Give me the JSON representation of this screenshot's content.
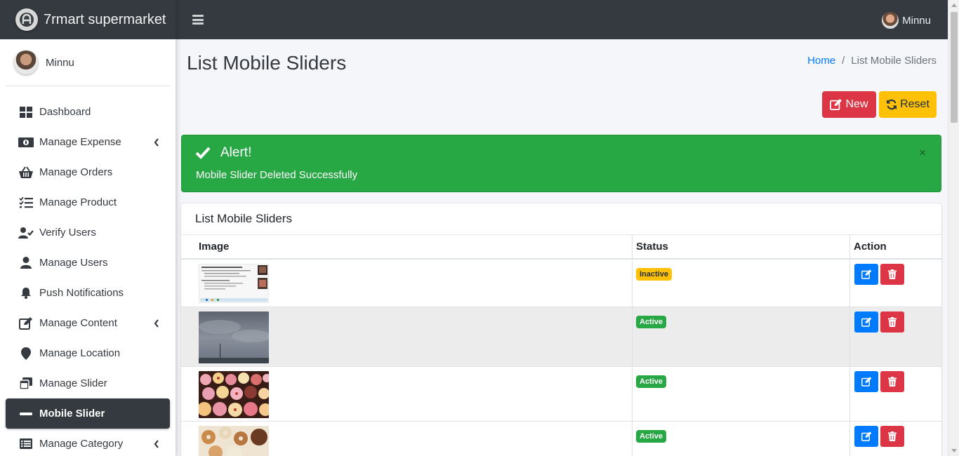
{
  "brand": {
    "title": "7rmart supermarket"
  },
  "user": {
    "name": "Minnu"
  },
  "topbar": {
    "user_name": "Minnu"
  },
  "sidebar": {
    "items": [
      {
        "label": "Dashboard",
        "icon": "dashboard-icon"
      },
      {
        "label": "Manage Expense",
        "icon": "money-bill-icon"
      },
      {
        "label": "Manage Orders",
        "icon": "basket-icon"
      },
      {
        "label": "Manage Product",
        "icon": "tasks-icon"
      },
      {
        "label": "Verify Users",
        "icon": "user-check-icon"
      },
      {
        "label": "Manage Users",
        "icon": "user-icon"
      },
      {
        "label": "Push Notifications",
        "icon": "bell-icon"
      },
      {
        "label": "Manage Content",
        "icon": "edit-icon"
      },
      {
        "label": "Manage Location",
        "icon": "map-marker-icon"
      },
      {
        "label": "Manage Slider",
        "icon": "window-restore-icon"
      },
      {
        "label": "Mobile Slider",
        "icon": "minus-icon"
      },
      {
        "label": "Manage Category",
        "icon": "list-icon"
      }
    ]
  },
  "page": {
    "title": "List Mobile Sliders",
    "breadcrumb": {
      "home": "Home",
      "separator": "/",
      "current": "List Mobile Sliders"
    },
    "buttons": {
      "new": "New",
      "reset": "Reset"
    }
  },
  "alert": {
    "title": "Alert!",
    "message": "Mobile Slider Deleted Successfully",
    "close": "×"
  },
  "card": {
    "title": "List Mobile Sliders",
    "columns": {
      "image": "Image",
      "status": "Status",
      "action": "Action"
    },
    "rows": [
      {
        "image": "screenshot-document-thumbnail",
        "status": "Inactive"
      },
      {
        "image": "cloudy-sky-thumbnail",
        "status": "Active"
      },
      {
        "image": "cupcakes-thumbnail",
        "status": "Active"
      },
      {
        "image": "donuts-thumbnail",
        "status": "Active"
      }
    ]
  },
  "colors": {
    "navbar": "#343a40",
    "danger": "#dc3545",
    "warning": "#ffc107",
    "success": "#28a745",
    "primary": "#007bff"
  }
}
